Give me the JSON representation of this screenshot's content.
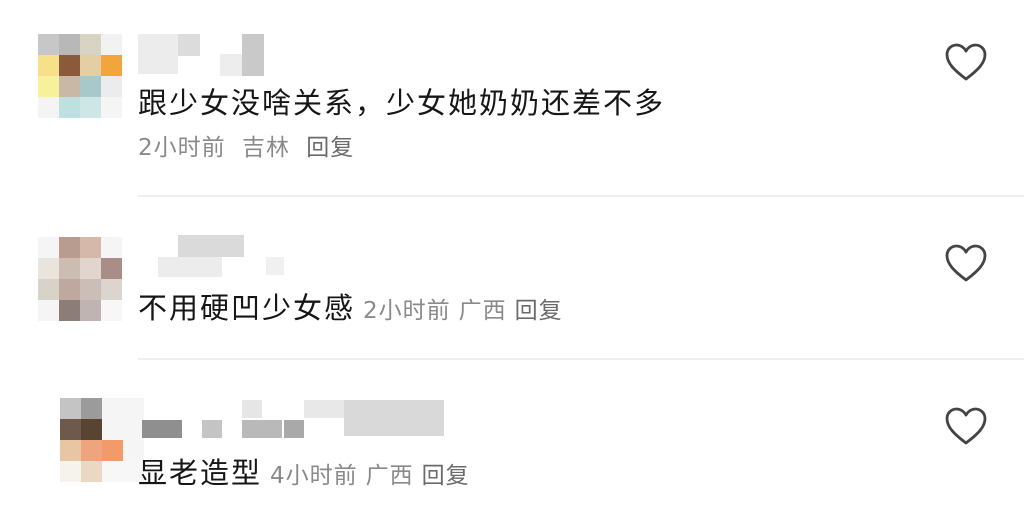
{
  "comments": [
    {
      "content": "跟少女没啥关系，少女她奶奶还差不多",
      "time": "2小时前",
      "location": "吉林",
      "reply_label": "回复",
      "avatar_colors": [
        "#c7c7c7",
        "#b8b8b8",
        "#d9d3c4",
        "#f2f2f2",
        "#f6e08a",
        "#8a5a3a",
        "#e3cfa3",
        "#f2a53a",
        "#f7f19b",
        "#c9b8a6",
        "#a8c9c9",
        "#ececec",
        "#f4f4f4",
        "#bfe0e0",
        "#cfe6e6",
        "#f5f5f5"
      ]
    },
    {
      "content": "不用硬凹少女感",
      "time": "2小时前",
      "location": "广西",
      "reply_label": "回复",
      "avatar_colors": [
        "#f5f5f5",
        "#b89c8f",
        "#d5b8aa",
        "#f5f5f5",
        "#e9e5dc",
        "#cdbcb1",
        "#e1d6ce",
        "#a98e87",
        "#d8d3c8",
        "#bfa8a0",
        "#cbbdb7",
        "#dcd4cf",
        "#f5f5f5",
        "#8c7d78",
        "#bfb4b1",
        "#f7f7f7"
      ]
    },
    {
      "content": "显老造型",
      "time": "4小时前",
      "location": "广西",
      "reply_label": "回复",
      "avatar_colors": [
        "#c4c4c4",
        "#9b9b9b",
        "#f5f5f5",
        "#f5f5f5",
        "#6e5a4a",
        "#584433",
        "#f5f5f5",
        "#f5f5f5",
        "#e8c6a4",
        "#eea57d",
        "#f29a6a",
        "#f5f5f5",
        "#f6f2ec",
        "#ead8c4",
        "#f7f7f7",
        "#f7f7f7"
      ]
    }
  ],
  "icons": {
    "like": "heart-outline-icon"
  }
}
